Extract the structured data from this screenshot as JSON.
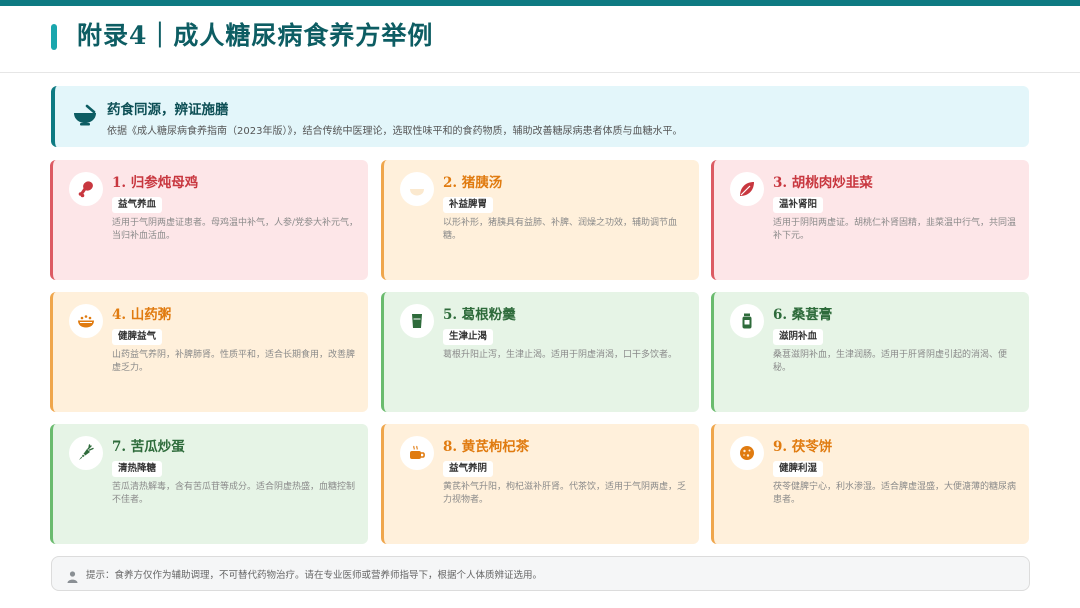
{
  "page": {
    "title": "附录4｜成人糖尿病食养方举例",
    "accent_color": "#0e7a82"
  },
  "intro": {
    "icon": "mortar-pestle-icon",
    "title": "药食同源，辨证施膳",
    "text": "依据《成人糖尿病食养指南（2023年版）》，结合传统中医理论，选取性味平和的食药物质，辅助改善糖尿病患者体质与血糖水平。"
  },
  "cards": [
    {
      "icon": "chicken-leg-icon",
      "title": "1. 归参炖母鸡",
      "tag": "益气养血",
      "desc": "适用于气阴两虚证患者。母鸡温中补气，人参/党参大补元气，当归补血活血。",
      "theme": "red"
    },
    {
      "icon": "soup-bowl-icon",
      "title": "2. 猪胰汤",
      "tag": "补益脾胃",
      "desc": "以形补形，猪胰具有益肺、补脾、润燥之功效，辅助调节血糖。",
      "theme": "orange"
    },
    {
      "icon": "leaf-icon",
      "title": "3. 胡桃肉炒韭菜",
      "tag": "温补肾阳",
      "desc": "适用于阴阳两虚证。胡桃仁补肾固精，韭菜温中行气，共同温补下元。",
      "theme": "red"
    },
    {
      "icon": "porridge-bowl-icon",
      "title": "4. 山药粥",
      "tag": "健脾益气",
      "desc": "山药益气养阴，补脾肺肾。性质平和，适合长期食用，改善脾虚乏力。",
      "theme": "orange"
    },
    {
      "icon": "glass-icon",
      "title": "5. 葛根粉羹",
      "tag": "生津止渴",
      "desc": "葛根升阳止泻，生津止渴。适用于阴虚消渴，口干多饮者。",
      "theme": "green"
    },
    {
      "icon": "jar-icon",
      "title": "6. 桑葚膏",
      "tag": "滋阴补血",
      "desc": "桑葚滋阴补血，生津润肠。适用于肝肾阴虚引起的消渴、便秘。",
      "theme": "green"
    },
    {
      "icon": "carrot-icon",
      "title": "7. 苦瓜炒蛋",
      "tag": "清热降糖",
      "desc": "苦瓜清热解毒，含有苦瓜苷等成分。适合阴虚热盛，血糖控制不佳者。",
      "theme": "green"
    },
    {
      "icon": "mug-icon",
      "title": "8. 黄芪枸杞茶",
      "tag": "益气养阴",
      "desc": "黄芪补气升阳，枸杞滋补肝肾。代茶饮，适用于气阴两虚，乏力视物者。",
      "theme": "orange"
    },
    {
      "icon": "cookie-icon",
      "title": "9. 茯苓饼",
      "tag": "健脾利湿",
      "desc": "茯苓健脾宁心，利水渗湿。适合脾虚湿盛，大便溏薄的糖尿病患者。",
      "theme": "orange"
    }
  ],
  "note": {
    "icon": "doctor-icon",
    "text": "提示：食养方仅作为辅助调理，不可替代药物治疗。请在专业医师或营养师指导下，根据个人体质辨证选用。"
  }
}
